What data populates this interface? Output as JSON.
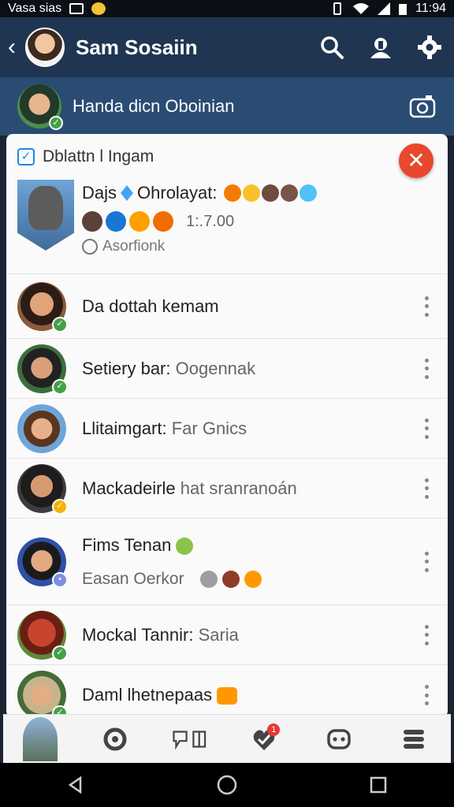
{
  "status_bar": {
    "carrier": "Vasa sias",
    "time": "11:94"
  },
  "app_bar": {
    "title": "Sam Sosaiin"
  },
  "sub_header": {
    "title": "Handa dicn Oboinian"
  },
  "card": {
    "title": "Dblattn l Ingam",
    "featured": {
      "name": "Dajs",
      "name_suffix": "Ohrolayat:",
      "time": "1:.7.00",
      "location": "Asorfionk"
    },
    "rows": [
      {
        "name": "Da dottah kemam",
        "sub": ""
      },
      {
        "name": "Setiery bar:",
        "sub": "Oogennak"
      },
      {
        "name": "Llitaimgart:",
        "sub": "Far Gnics"
      },
      {
        "name": "Mackadeirle",
        "sub": "hat sranranoán"
      },
      {
        "name": "Fims Tenan",
        "sub": "",
        "line2": "Easan Oerkor"
      },
      {
        "name": "Mockal Tannir:",
        "sub": "Saria"
      },
      {
        "name": "Daml lhetnepaas",
        "sub": ""
      }
    ]
  },
  "bottom_nav": {
    "badge": "1"
  },
  "colors": {
    "app_bar": "#1f3552",
    "sub_header": "#2a4c73",
    "close_red": "#e8482b",
    "online_green": "#43a047"
  }
}
